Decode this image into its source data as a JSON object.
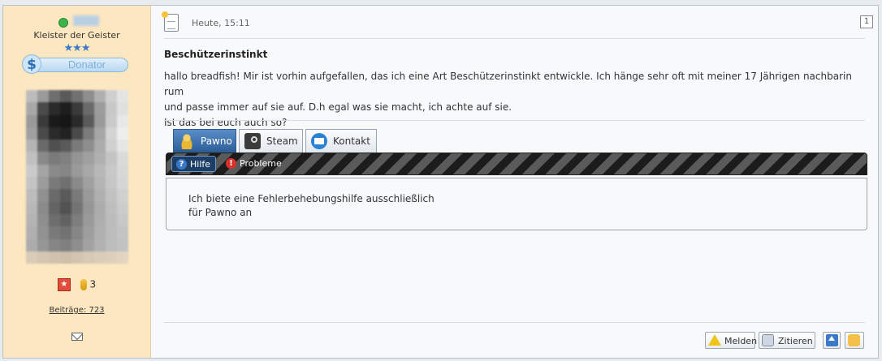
{
  "sidebar": {
    "rank": "Kleister der Geister",
    "stars": "★★★",
    "donator_label": "Donator",
    "award_count": "3",
    "posts_label": "Beiträge: 723"
  },
  "post": {
    "time": "Heute, 15:11",
    "number": "1",
    "title": "Beschützerinstinkt",
    "body": [
      "hallo breadfish! Mir ist vorhin aufgefallen, das ich eine Art Beschützerinstinkt entwickle. Ich hänge sehr oft mit meiner 17 Jährigen nachbarin rum",
      "und passe immer auf sie auf. D.h egal was sie macht, ich achte auf sie.",
      "Ist das bei euch auch so?"
    ]
  },
  "signature": {
    "tabs": [
      {
        "label": "Pawno",
        "icon": "pawno-icon",
        "active": true
      },
      {
        "label": "Steam",
        "icon": "steam-icon",
        "active": false
      },
      {
        "label": "Kontakt",
        "icon": "mail-icon",
        "active": false
      }
    ],
    "subtabs": [
      {
        "label": "Hilfe",
        "icon": "help-icon",
        "active": true
      },
      {
        "label": "Probleme",
        "icon": "warning-icon",
        "active": false
      }
    ],
    "panel_lines": [
      "Ich biete eine Fehlerbehebungshilfe ausschließlich",
      "für Pawno an"
    ]
  },
  "actions": {
    "report": "Melden",
    "quote": "Zitieren"
  },
  "colors": {
    "sidebar_bg": "#fde7c0",
    "post_bg": "#f7f9fb",
    "active_tab": "#2b5c96"
  }
}
